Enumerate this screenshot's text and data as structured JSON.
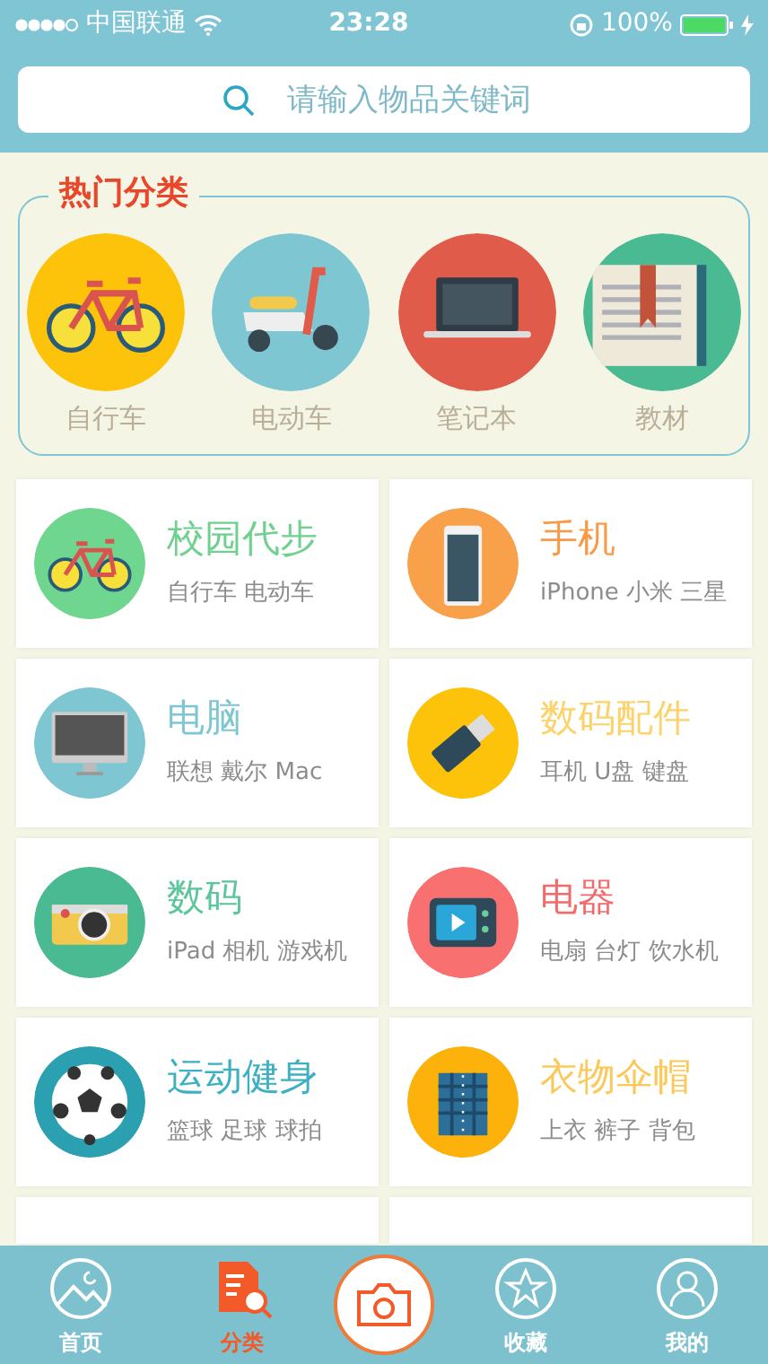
{
  "status_bar": {
    "carrier": "中国联通",
    "time": "23:28",
    "battery": "100%"
  },
  "search": {
    "placeholder": "请输入物品关键词"
  },
  "hot": {
    "title": "热门分类",
    "items": [
      {
        "label": "自行车",
        "kind": "bicycle"
      },
      {
        "label": "电动车",
        "kind": "scooter"
      },
      {
        "label": "笔记本",
        "kind": "laptop"
      },
      {
        "label": "教材",
        "kind": "book"
      }
    ]
  },
  "categories": [
    {
      "title": "校园代步",
      "subtitle": "自行车 电动车",
      "color": "#6fd08f",
      "kind": "bicycle"
    },
    {
      "title": "手机",
      "subtitle": "iPhone 小米 三星",
      "color": "#f89a48",
      "kind": "phone"
    },
    {
      "title": "电脑",
      "subtitle": "联想 戴尔 Mac",
      "color": "#7fc6d3",
      "kind": "monitor"
    },
    {
      "title": "数码配件",
      "subtitle": "耳机 U盘 键盘",
      "color": "#fbd36a",
      "kind": "usb"
    },
    {
      "title": "数码",
      "subtitle": "iPad 相机 游戏机",
      "color": "#5cc69b",
      "kind": "camera"
    },
    {
      "title": "电器",
      "subtitle": "电扇 台灯 饮水机",
      "color": "#f36a6a",
      "kind": "tv"
    },
    {
      "title": "运动健身",
      "subtitle": "篮球 足球 球拍",
      "color": "#3eb0c3",
      "kind": "ball"
    },
    {
      "title": "衣物伞帽",
      "subtitle": "上衣 裤子 背包",
      "color": "#fbc95a",
      "kind": "shirt"
    }
  ],
  "tab_bar": [
    {
      "kind": "tab",
      "label": "首页",
      "selected": false
    },
    {
      "kind": "tab",
      "label": "分类",
      "selected": true
    },
    {
      "kind": "camera"
    },
    {
      "kind": "tab",
      "label": "收藏",
      "selected": false
    },
    {
      "kind": "tab",
      "label": "我的",
      "selected": false
    }
  ]
}
